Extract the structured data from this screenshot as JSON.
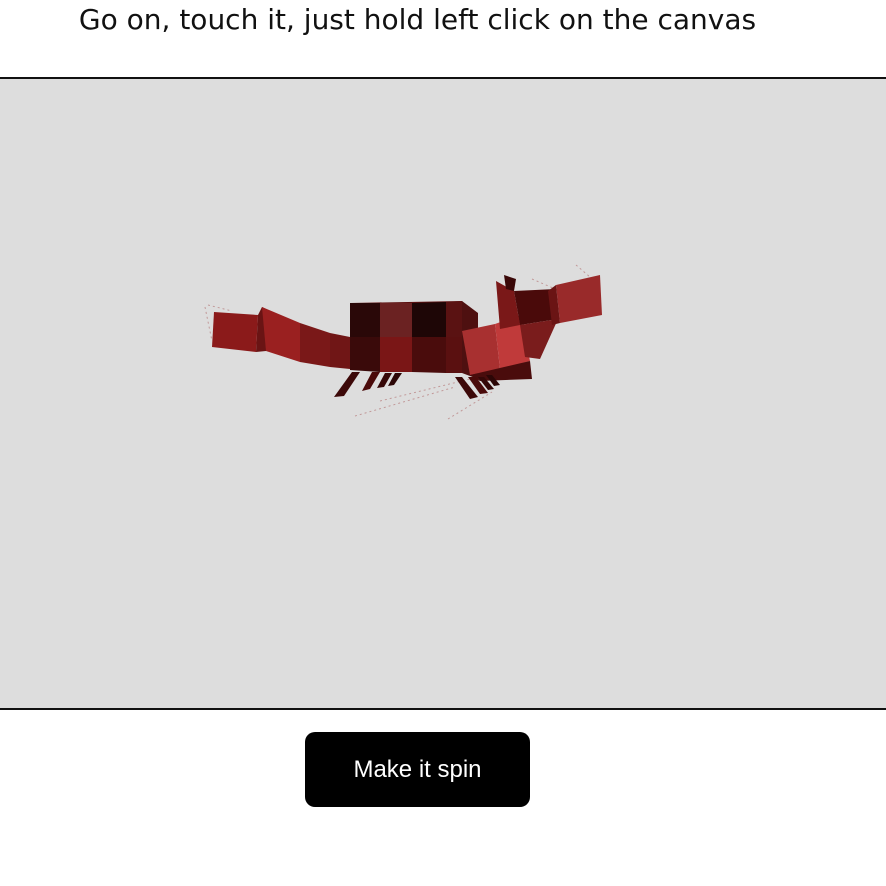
{
  "header": {
    "instruction": "Go on, touch it, just hold left click on the canvas"
  },
  "canvas": {
    "background_color": "#dddddd",
    "model_icon": "blocky-red-fox-icon"
  },
  "controls": {
    "spin_label": "Make it spin"
  }
}
